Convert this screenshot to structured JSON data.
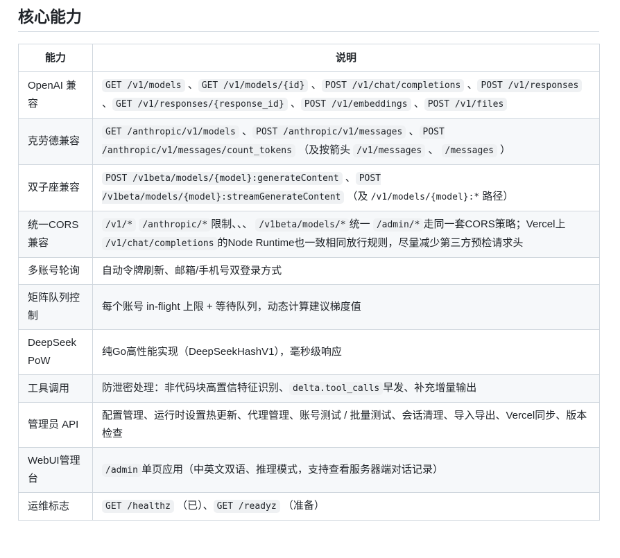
{
  "heading": "核心能力",
  "table": {
    "headers": [
      "能力",
      "说明"
    ],
    "rows": [
      {
        "name": "OpenAI 兼容",
        "parts": [
          {
            "t": "code",
            "v": "GET /v1/models"
          },
          {
            "t": "text",
            "v": " 、"
          },
          {
            "t": "code",
            "v": "GET /v1/models/{id}"
          },
          {
            "t": "text",
            "v": " 、"
          },
          {
            "t": "code",
            "v": "POST /v1/chat/completions"
          },
          {
            "t": "text",
            "v": " 、"
          },
          {
            "t": "code",
            "v": "POST /v1/responses"
          },
          {
            "t": "text",
            "v": " 、"
          },
          {
            "t": "code",
            "v": "GET /v1/responses/{response_id}"
          },
          {
            "t": "text",
            "v": " 、"
          },
          {
            "t": "code",
            "v": "POST /v1/embeddings"
          },
          {
            "t": "text",
            "v": " 、"
          },
          {
            "t": "code",
            "v": "POST /v1/files"
          }
        ]
      },
      {
        "name": "克劳德兼容",
        "parts": [
          {
            "t": "code",
            "v": "GET /anthropic/v1/models"
          },
          {
            "t": "text",
            "v": " 、"
          },
          {
            "t": "code",
            "v": "POST /anthropic/v1/messages"
          },
          {
            "t": "text",
            "v": " 、"
          },
          {
            "t": "code",
            "v": "POST /anthropic/v1/messages/count_tokens"
          },
          {
            "t": "text",
            "v": " （及按箭头 "
          },
          {
            "t": "code",
            "v": "/v1/messages"
          },
          {
            "t": "text",
            "v": " 、 "
          },
          {
            "t": "code",
            "v": "/messages"
          },
          {
            "t": "text",
            "v": " ）"
          }
        ]
      },
      {
        "name": "双子座兼容",
        "parts": [
          {
            "t": "code",
            "v": "POST /v1beta/models/{model}:generateContent"
          },
          {
            "t": "text",
            "v": " 、"
          },
          {
            "t": "code",
            "v": "POST /v1beta/models/{model}:streamGenerateContent"
          },
          {
            "t": "text",
            "v": " （及 "
          },
          {
            "t": "mono",
            "v": "/v1/models/{model}:*"
          },
          {
            "t": "text",
            "v": " 路径）"
          }
        ]
      },
      {
        "name": "统一CORS兼容",
        "parts": [
          {
            "t": "code",
            "v": "/v1/*"
          },
          {
            "t": "text",
            "v": " "
          },
          {
            "t": "code",
            "v": "/anthropic/*"
          },
          {
            "t": "text",
            "v": "限制、、、 "
          },
          {
            "t": "code",
            "v": "/v1beta/models/*"
          },
          {
            "t": "text",
            "v": "统一 "
          },
          {
            "t": "code",
            "v": "/admin/*"
          },
          {
            "t": "text",
            "v": "走同一套CORS策略；Vercel上 "
          },
          {
            "t": "code",
            "v": "/v1/chat/completions"
          },
          {
            "t": "text",
            "v": "的Node Runtime也一致相同放行规则，尽量减少第三方预检请求头"
          }
        ]
      },
      {
        "name": "多账号轮询",
        "parts": [
          {
            "t": "text",
            "v": "自动令牌刷新、邮箱/手机号双登录方式"
          }
        ]
      },
      {
        "name": "矩阵队列控制",
        "parts": [
          {
            "t": "text",
            "v": "每个账号 in-flight 上限 + 等待队列，动态计算建议梯度值"
          }
        ]
      },
      {
        "name": "DeepSeek PoW",
        "parts": [
          {
            "t": "text",
            "v": "纯Go高性能实现（DeepSeekHashV1），毫秒级响应"
          }
        ]
      },
      {
        "name": "工具调用",
        "parts": [
          {
            "t": "text",
            "v": "防泄密处理：非代码块高置信特征识别、"
          },
          {
            "t": "code",
            "v": "delta.tool_calls"
          },
          {
            "t": "text",
            "v": "早发、补充增量输出"
          }
        ]
      },
      {
        "name": "管理员 API",
        "parts": [
          {
            "t": "text",
            "v": "配置管理、运行时设置热更新、代理管理、账号测试 / 批量测试、会话清理、导入导出、Vercel同步、版本检查"
          }
        ]
      },
      {
        "name": "WebUI管理台",
        "parts": [
          {
            "t": "code",
            "v": "/admin"
          },
          {
            "t": "text",
            "v": "单页应用（中英文双语、推理模式，支持查看服务器端对话记录）"
          }
        ]
      },
      {
        "name": "运维标志",
        "parts": [
          {
            "t": "code",
            "v": "GET /healthz"
          },
          {
            "t": "text",
            "v": " （已）、"
          },
          {
            "t": "code",
            "v": "GET /readyz"
          },
          {
            "t": "text",
            "v": " （准备）"
          }
        ]
      }
    ]
  }
}
